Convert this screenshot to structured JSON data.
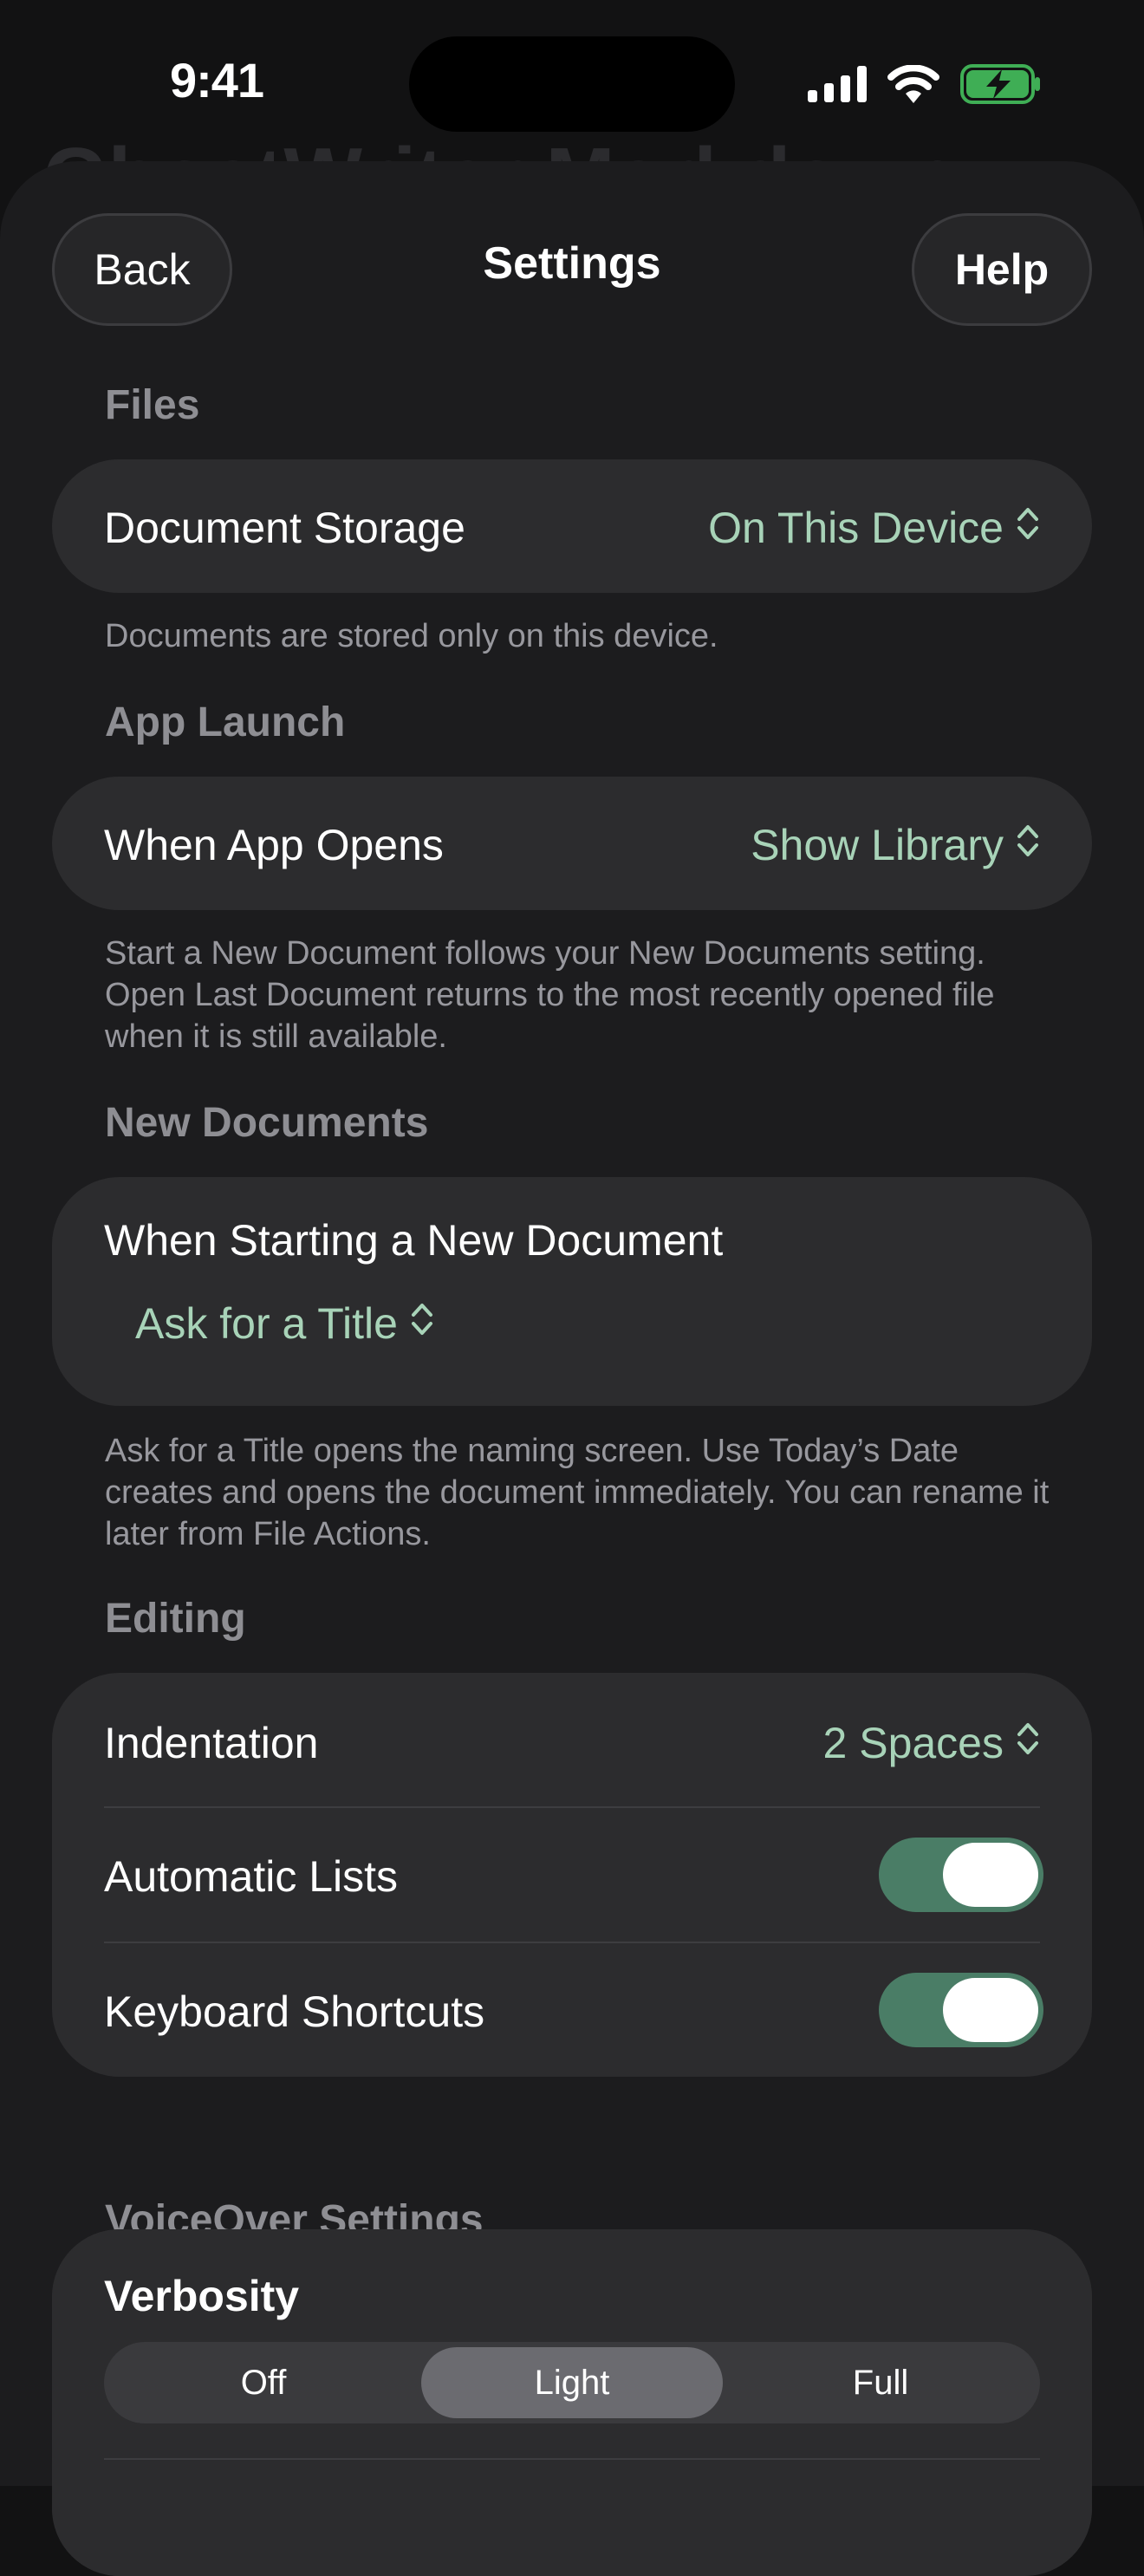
{
  "status_bar": {
    "time": "9:41"
  },
  "background": {
    "title": "GhostWriter Markdown"
  },
  "header": {
    "back_label": "Back",
    "title": "Settings",
    "help_label": "Help"
  },
  "files": {
    "header": "Files",
    "row_label": "Document Storage",
    "row_value": "On This Device",
    "footnote": "Documents are stored only on this device."
  },
  "app_launch": {
    "header": "App Launch",
    "row_label": "When App Opens",
    "row_value": "Show Library",
    "footnote": "Start a New Document follows your New Documents setting. Open Last Document returns to the most recently opened file when it is still available."
  },
  "new_documents": {
    "header": "New Documents",
    "row_label": "When Starting a New Document",
    "row_value": "Ask for a Title",
    "footnote": "Ask for a Title opens the naming screen. Use Today’s Date creates and opens the document immediately. You can rename it later from File Actions."
  },
  "editing": {
    "header": "Editing",
    "indentation_label": "Indentation",
    "indentation_value": "2 Spaces",
    "automatic_lists_label": "Automatic Lists",
    "automatic_lists_on": true,
    "keyboard_shortcuts_label": "Keyboard Shortcuts",
    "keyboard_shortcuts_on": true
  },
  "voiceover": {
    "header": "VoiceOver Settings",
    "verbosity_label": "Verbosity",
    "options": [
      "Off",
      "Light",
      "Full"
    ],
    "selected": "Light"
  },
  "colors": {
    "accent_value": "#a8d3b8",
    "toggle_on": "#4a7d66",
    "sheet_background": "#1c1c1e",
    "card_background": "#2c2c2e"
  }
}
